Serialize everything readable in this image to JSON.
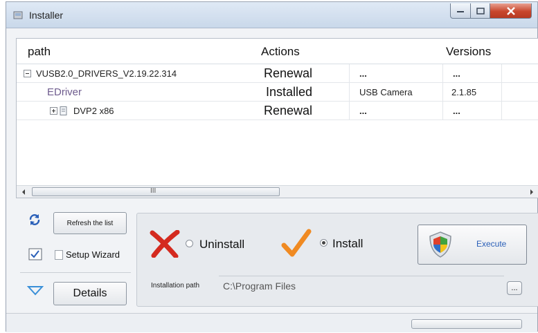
{
  "window": {
    "title": "Installer"
  },
  "table": {
    "headers": {
      "path": "path",
      "actions": "Actions",
      "versions": "Versions"
    },
    "rows": [
      {
        "path": "VUSB2.0_DRIVERS_V2.19.22.314",
        "action": "Renewal",
        "device": "...",
        "version": "..."
      },
      {
        "path": "EDriver",
        "action": "Installed",
        "device": "USB Camera",
        "version": "2.1.85"
      },
      {
        "path": "DVP2 x86",
        "action": "Renewal",
        "device": "...",
        "version": "..."
      }
    ],
    "scroll_marker": "III"
  },
  "left": {
    "refresh_label": "Refresh the list",
    "setup_wizard_label": "Setup Wizard",
    "details_label": "Details"
  },
  "right": {
    "uninstall_label": "Uninstall",
    "install_label": "Install",
    "execute_label": "Execute",
    "install_path_label": "Installation path",
    "install_path_value": "C:\\Program Files",
    "browse_label": "..."
  },
  "colors": {
    "accent": "#2a5fb8",
    "uninstall": "#d42a1f",
    "install": "#f08a22"
  }
}
